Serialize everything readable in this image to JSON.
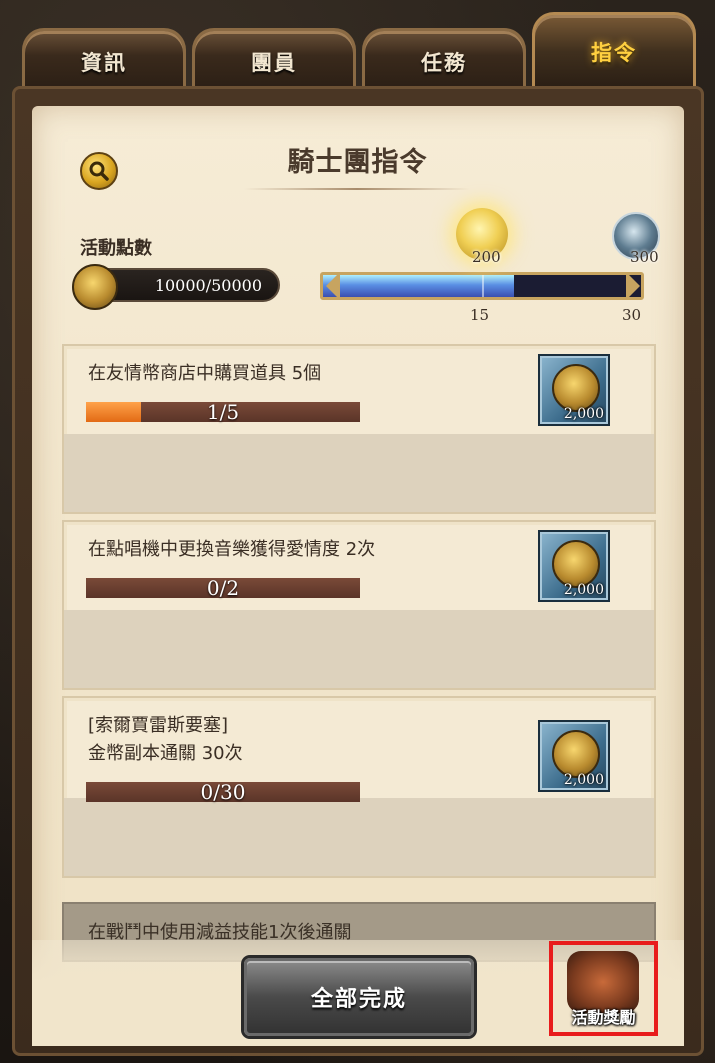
{
  "tabs": [
    {
      "label": "資訊",
      "active": false
    },
    {
      "label": "團員",
      "active": false
    },
    {
      "label": "任務",
      "active": false
    },
    {
      "label": "指令",
      "active": true
    }
  ],
  "header": {
    "title": "騎士團指令"
  },
  "activity": {
    "label": "活動點數",
    "points_text": "10000/50000",
    "progress_fraction": 0.6,
    "milestones": [
      {
        "value": "200",
        "state": "reached",
        "color": "#f0cf54"
      },
      {
        "value": "300",
        "state": "locked",
        "color": "#5e7c90"
      }
    ],
    "ticks": [
      "15",
      "30"
    ]
  },
  "tasks": [
    {
      "line1": "在友情幣商店中購買道具 5個",
      "line2": "",
      "progress_text": "1/5",
      "progress": 0.2,
      "reward_amount": "2,000"
    },
    {
      "line1": "在點唱機中更換音樂獲得愛情度 2次",
      "line2": "",
      "progress_text": "0/2",
      "progress": 0,
      "reward_amount": "2,000"
    },
    {
      "line1": "[索爾賈雷斯要塞]",
      "line2": "金幣副本通關 30次",
      "progress_text": "0/30",
      "progress": 0,
      "reward_amount": "2,000"
    }
  ],
  "partial_task": {
    "text": "在戰鬥中使用減益技能1次後通關"
  },
  "footer": {
    "complete_all_label": "全部完成",
    "event_reward_label": "活動獎勵"
  },
  "colors": {
    "active_tab": "#ffd040",
    "highlight_box": "#e81c1c",
    "progress_fill": "#e26a14"
  }
}
